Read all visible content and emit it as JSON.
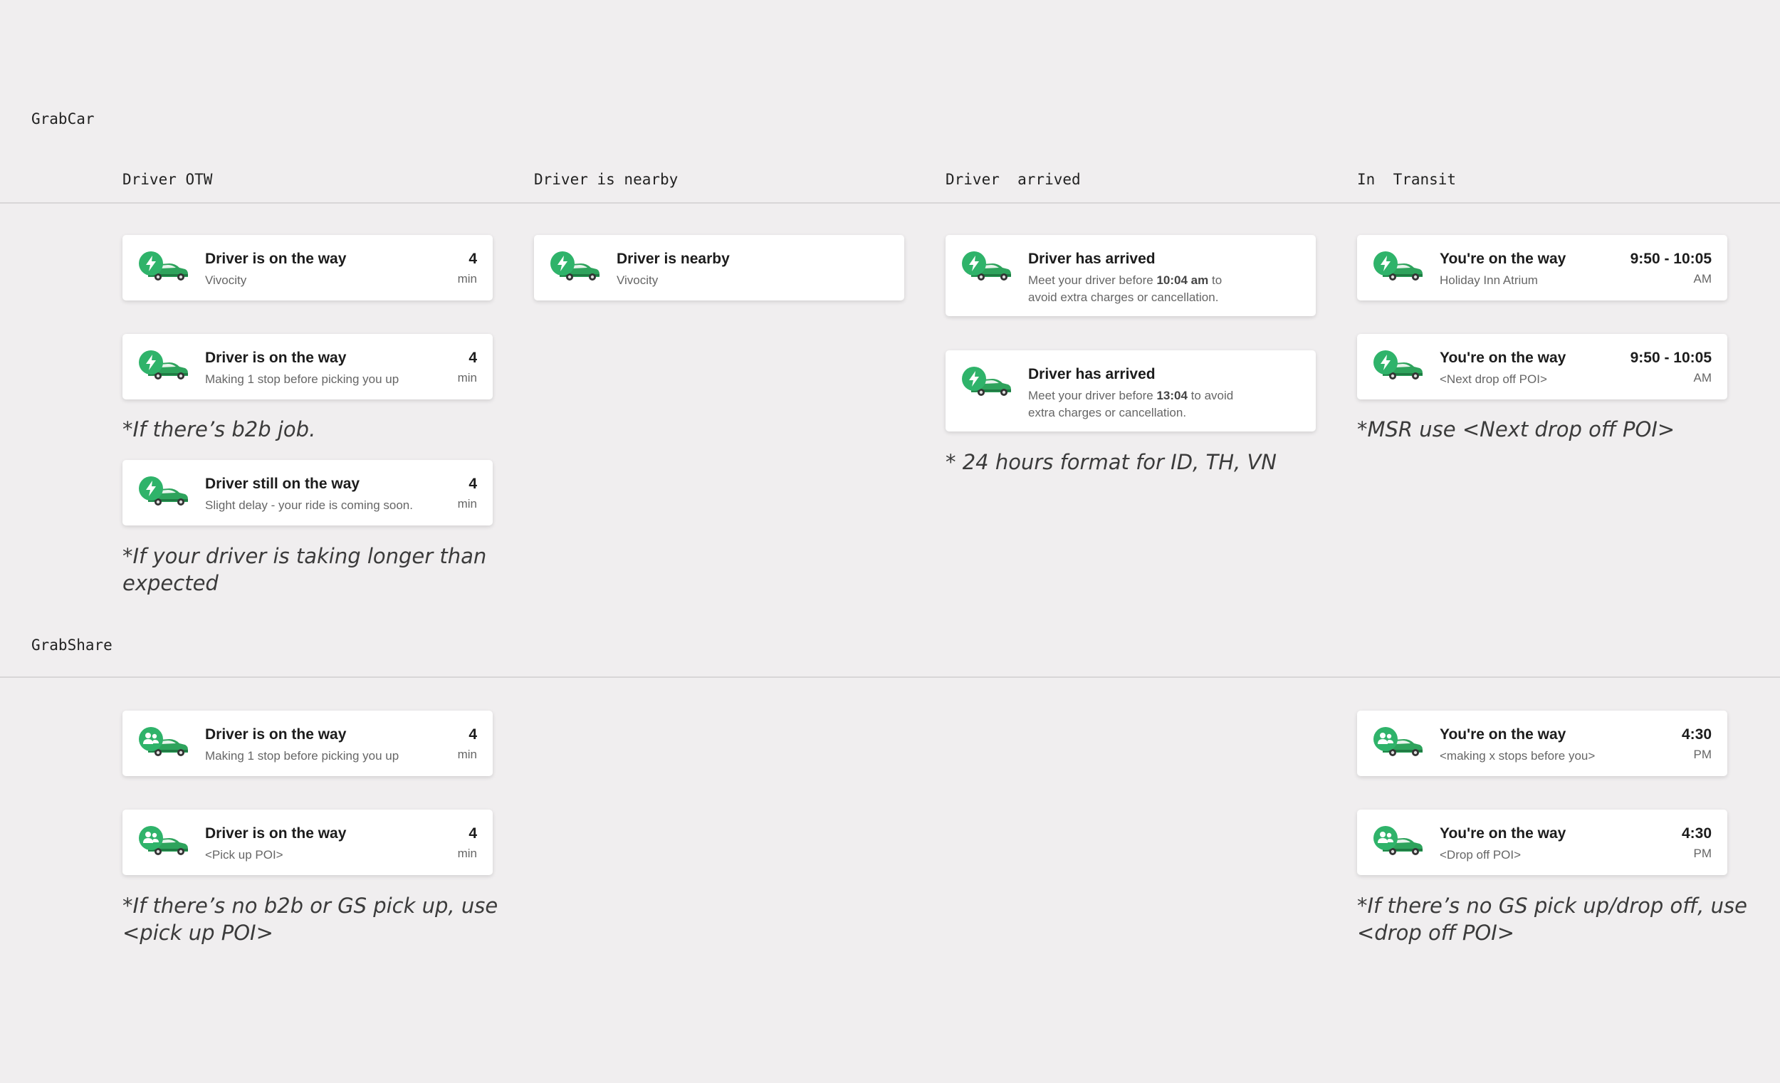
{
  "sections": {
    "grabcar": "GrabCar",
    "grabshare": "GrabShare"
  },
  "columns": {
    "otw": "Driver OTW",
    "nearby": "Driver is nearby",
    "arrived": "Driver  arrived",
    "transit": "In  Transit"
  },
  "colors": {
    "brand_green": "#2fb36a",
    "car_green": "#2ea35c"
  },
  "icons": {
    "express": "lightning-icon",
    "share": "people-icon",
    "car": "car-icon"
  },
  "cards": {
    "car_otw_1": {
      "title": "Driver is on the way",
      "sub": "Vivocity",
      "eta": "4",
      "unit": "min"
    },
    "car_otw_2": {
      "title": "Driver is on the way",
      "sub": "Making 1 stop before picking you up",
      "eta": "4",
      "unit": "min"
    },
    "car_otw_3": {
      "title": "Driver still on the way",
      "sub": "Slight delay - your ride is coming soon.",
      "eta": "4",
      "unit": "min"
    },
    "car_nearby": {
      "title": "Driver is nearby",
      "sub": "Vivocity"
    },
    "car_arrived_1": {
      "title": "Driver has arrived",
      "sub_pre": "Meet your driver before ",
      "sub_time": "10:04 am",
      "sub_post": " to avoid extra charges or cancellation."
    },
    "car_arrived_2": {
      "title": "Driver has arrived",
      "sub_pre": "Meet your driver before ",
      "sub_time": "13:04",
      "sub_post": " to avoid extra charges or cancellation."
    },
    "car_transit_1": {
      "title": "You're on the way",
      "sub": "Holiday Inn Atrium",
      "eta": "9:50 - 10:05",
      "unit": "AM"
    },
    "car_transit_2": {
      "title": "You're on the way",
      "sub": "<Next drop off POI>",
      "eta": "9:50 - 10:05",
      "unit": "AM"
    },
    "share_otw_1": {
      "title": "Driver is on the way",
      "sub": "Making 1 stop before picking you up",
      "eta": "4",
      "unit": "min"
    },
    "share_otw_2": {
      "title": "Driver is on the way",
      "sub": "<Pick up POI>",
      "eta": "4",
      "unit": "min"
    },
    "share_transit_1": {
      "title": "You're on the way",
      "sub": "<making x stops before you>",
      "eta": "4:30",
      "unit": "PM"
    },
    "share_transit_2": {
      "title": "You're on the way",
      "sub": "<Drop off POI>",
      "eta": "4:30",
      "unit": "PM"
    }
  },
  "notes": {
    "b2b": "*If there’s b2b job.",
    "longer": "*If your driver is taking longer than expected",
    "hours": "* 24 hours format for ID, TH, VN",
    "msr": "*MSR use <Next drop off POI>",
    "no_b2b": "*If there’s no b2b or GS pick up, use <pick up POI>",
    "no_gs": "*If there’s no GS pick up/drop off, use <drop off POI>"
  }
}
